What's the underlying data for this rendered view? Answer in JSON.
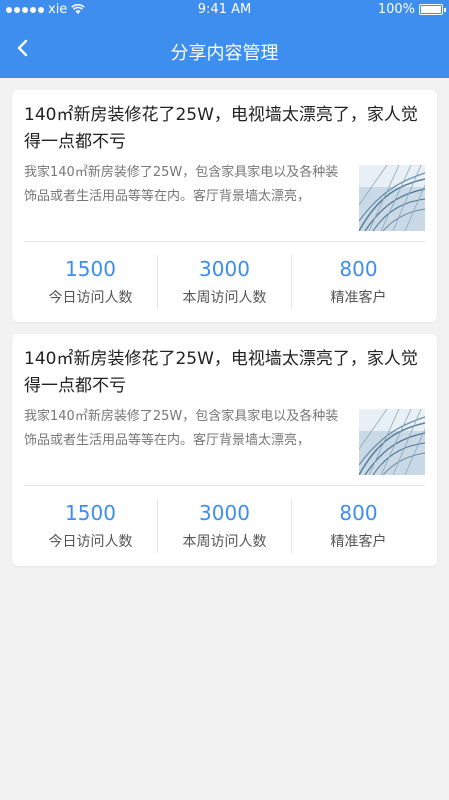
{
  "status_bar": {
    "carrier": "xie",
    "time": "9:41 AM",
    "battery": "100%"
  },
  "nav": {
    "title": "分享内容管理",
    "back_icon": "chevron-left-icon"
  },
  "cards": [
    {
      "title": "140㎡新房装修花了25W，电视墙太漂亮了，家人觉得一点都不亏",
      "desc": "我家140㎡新房装修了25W，包含家具家电以及各种装饰品或者生活用品等等在内。客厅背景墙太漂亮，",
      "stats": [
        {
          "value": "1500",
          "label": "今日访问人数"
        },
        {
          "value": "3000",
          "label": "本周访问人数"
        },
        {
          "value": "800",
          "label": "精准客户"
        }
      ]
    },
    {
      "title": "140㎡新房装修花了25W，电视墙太漂亮了，家人觉得一点都不亏",
      "desc": "我家140㎡新房装修了25W，包含家具家电以及各种装饰品或者生活用品等等在内。客厅背景墙太漂亮，",
      "stats": [
        {
          "value": "1500",
          "label": "今日访问人数"
        },
        {
          "value": "3000",
          "label": "本周访问人数"
        },
        {
          "value": "800",
          "label": "精准客户"
        }
      ]
    }
  ],
  "colors": {
    "accent": "#3d8eef",
    "background": "#f2f2f2"
  }
}
